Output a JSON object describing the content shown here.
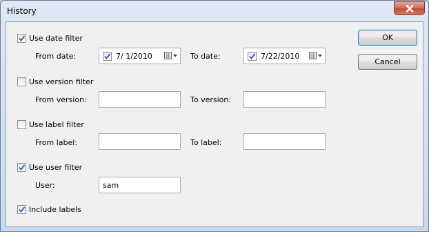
{
  "window": {
    "title": "History"
  },
  "date_filter": {
    "label": "Use date filter",
    "checked": true,
    "from_label": "From date:",
    "from_checked": true,
    "from_value": "7/ 1/2010",
    "to_label": "To date:",
    "to_checked": true,
    "to_value": "7/22/2010"
  },
  "version_filter": {
    "label": "Use version filter",
    "checked": false,
    "from_label": "From version:",
    "from_value": "",
    "to_label": "To version:",
    "to_value": ""
  },
  "label_filter": {
    "label": "Use label filter",
    "checked": false,
    "from_label": "From label:",
    "from_value": "",
    "to_label": "To label:",
    "to_value": ""
  },
  "user_filter": {
    "label": "Use user filter",
    "checked": true,
    "user_label": "User:",
    "user_value": "sam"
  },
  "include_labels": {
    "label": "Include labels",
    "checked": true
  },
  "buttons": {
    "ok": "OK",
    "cancel": "Cancel"
  },
  "icons": {
    "close": "close-icon",
    "calendar": "calendar-dropdown-icon",
    "check": "checkmark-icon"
  }
}
